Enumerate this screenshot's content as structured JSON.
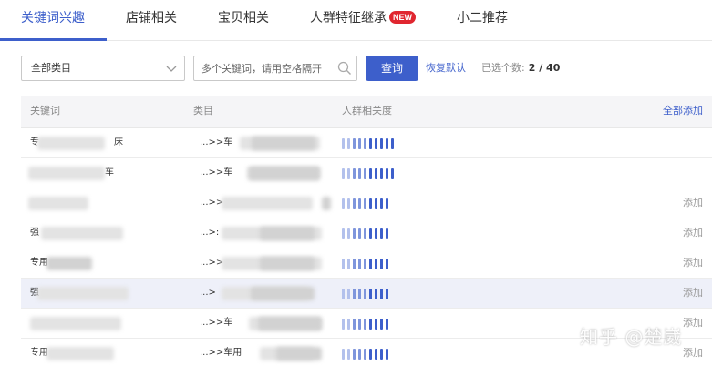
{
  "tabs": [
    {
      "label": "关键词兴趣",
      "active": true
    },
    {
      "label": "店铺相关"
    },
    {
      "label": "宝贝相关"
    },
    {
      "label": "人群特征继承",
      "badge": "NEW"
    },
    {
      "label": "小二推荐"
    }
  ],
  "filters": {
    "category_label": "全部类目",
    "search_placeholder": "多个关键词，请用空格隔开",
    "query_label": "查询",
    "reset_label": "恢复默认",
    "selected_label": "已选个数:",
    "selected_count": "2 / 40"
  },
  "table": {
    "columns": [
      "关键词",
      "类目",
      "人群相关度"
    ],
    "add_all_label": "全部添加",
    "add_label": "添加",
    "rows": [
      {
        "keyword_visible": [
          "专",
          "床"
        ],
        "category": "...>>车",
        "relevance": 10,
        "added": true
      },
      {
        "keyword_visible": [
          "",
          "车"
        ],
        "category": "...>>车",
        "relevance": 10,
        "added": true
      },
      {
        "keyword_visible": [
          "",
          ""
        ],
        "category": "...>>",
        "relevance": 9,
        "added": false
      },
      {
        "keyword_visible": [
          "强",
          ""
        ],
        "category": "...>:",
        "relevance": 9,
        "added": false
      },
      {
        "keyword_visible": [
          "专用",
          ""
        ],
        "category": "...>>",
        "relevance": 9,
        "added": false
      },
      {
        "keyword_visible": [
          "强",
          ""
        ],
        "category": "...>",
        "relevance": 9,
        "added": false
      },
      {
        "keyword_visible": [
          "",
          ""
        ],
        "category": "...>>车",
        "relevance": 9,
        "added": false
      },
      {
        "keyword_visible": [
          "专用",
          ""
        ],
        "category": "...>>车用",
        "relevance": 9,
        "added": false
      }
    ]
  },
  "watermark": "知乎 @楚崴",
  "colors": {
    "accent": "#3d5fcb",
    "badge": "#e0262f",
    "bar_strong": "#3d5fcb",
    "bar_mid": "#7e95dc",
    "bar_light": "#b3c1ec"
  }
}
